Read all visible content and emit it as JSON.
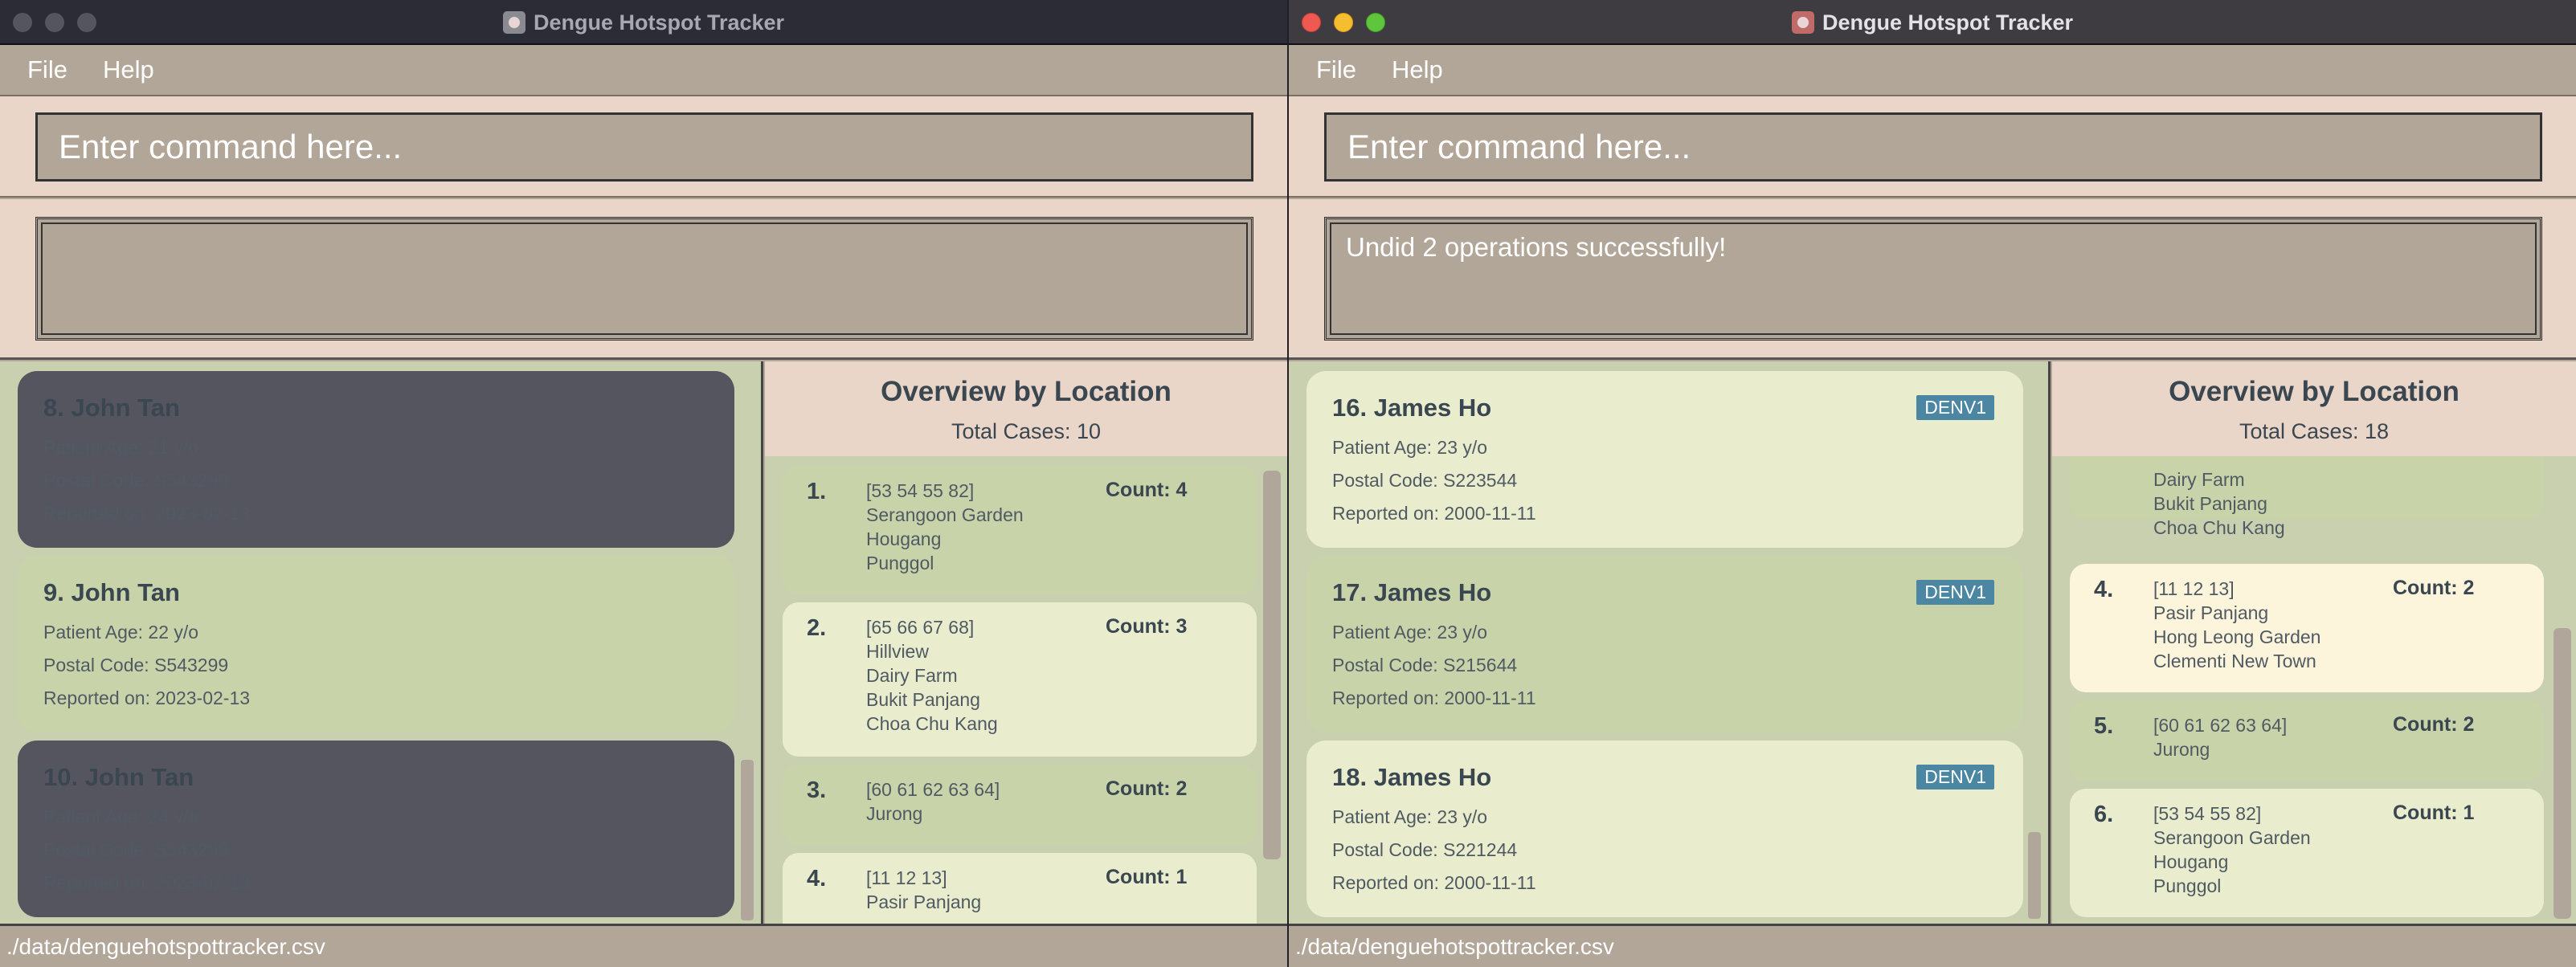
{
  "app_title": "Dengue Hotspot Tracker",
  "menu": {
    "file": "File",
    "help": "Help"
  },
  "command_placeholder": "Enter command here...",
  "status_path": "./data/denguehotspottracker.csv",
  "left": {
    "result_text": "",
    "patients": [
      {
        "name": "8. John Tan",
        "age": "Patient Age: 21 y/o",
        "postal": "Postal Code: S543299",
        "date": "Reported on: 2023-02-13"
      },
      {
        "name": "9. John Tan",
        "age": "Patient Age: 22 y/o",
        "postal": "Postal Code: S543299",
        "date": "Reported on: 2023-02-13"
      },
      {
        "name": "10. John Tan",
        "age": "Patient Age: 24 y/o",
        "postal": "Postal Code: S543299",
        "date": "Reported on: 2023-02-13"
      }
    ],
    "overview": {
      "title": "Overview by Location",
      "total": "Total Cases: 10",
      "locations": [
        {
          "num": "1.",
          "codes": "[53 54 55 82]",
          "places": [
            "Serangoon Garden",
            "Hougang",
            "Punggol"
          ],
          "count": "Count: 4"
        },
        {
          "num": "2.",
          "codes": "[65 66 67 68]",
          "places": [
            "Hillview",
            "Dairy Farm",
            "Bukit Panjang",
            "Choa Chu Kang"
          ],
          "count": "Count: 3"
        },
        {
          "num": "3.",
          "codes": "[60 61 62 63 64]",
          "places": [
            "Jurong"
          ],
          "count": "Count: 2"
        },
        {
          "num": "4.",
          "codes": "[11 12 13]",
          "places": [
            "Pasir Panjang"
          ],
          "count": "Count: 1"
        }
      ]
    }
  },
  "right": {
    "result_text": "Undid 2 operations successfully!",
    "patients": [
      {
        "name": "16. James Ho",
        "age": "Patient Age: 23 y/o",
        "postal": "Postal Code: S223544",
        "date": "Reported on: 2000-11-11",
        "tag": "DENV1"
      },
      {
        "name": "17. James Ho",
        "age": "Patient Age: 23 y/o",
        "postal": "Postal Code: S215644",
        "date": "Reported on: 2000-11-11",
        "tag": "DENV1"
      },
      {
        "name": "18. James Ho",
        "age": "Patient Age: 23 y/o",
        "postal": "Postal Code: S221244",
        "date": "Reported on: 2000-11-11",
        "tag": "DENV1"
      }
    ],
    "overview": {
      "title": "Overview by Location",
      "total": "Total Cases: 18",
      "partial_places": [
        "Dairy Farm",
        "Bukit Panjang",
        "Choa Chu Kang"
      ],
      "locations": [
        {
          "num": "4.",
          "codes": "[11 12 13]",
          "places": [
            "Pasir Panjang",
            "Hong Leong Garden",
            "Clementi New Town"
          ],
          "count": "Count: 2"
        },
        {
          "num": "5.",
          "codes": "[60 61 62 63 64]",
          "places": [
            "Jurong"
          ],
          "count": "Count: 2"
        },
        {
          "num": "6.",
          "codes": "[53 54 55 82]",
          "places": [
            "Serangoon Garden",
            "Hougang",
            "Punggol"
          ],
          "count": "Count: 1"
        }
      ]
    }
  }
}
